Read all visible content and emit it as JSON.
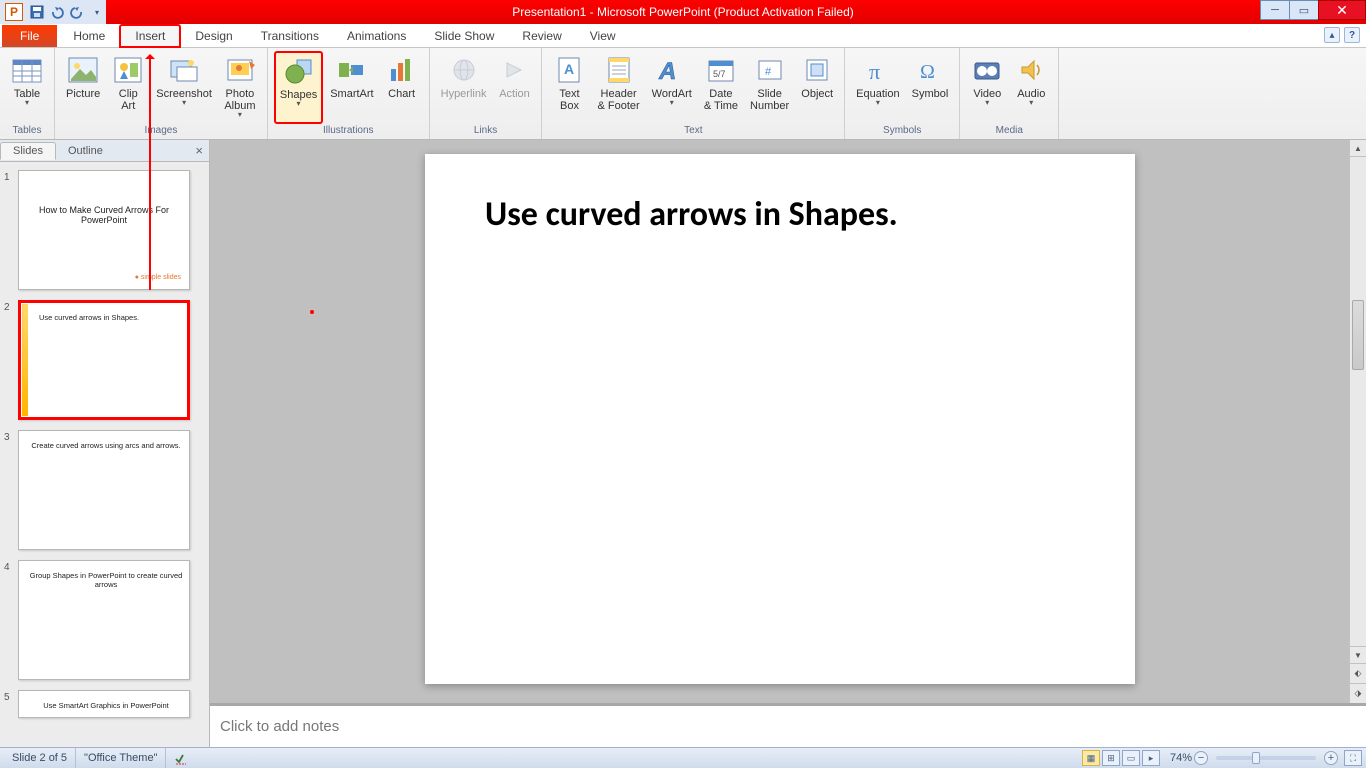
{
  "titlebar": {
    "title": "Presentation1 - Microsoft PowerPoint (Product Activation Failed)"
  },
  "tabs": {
    "file": "File",
    "items": [
      "Home",
      "Insert",
      "Design",
      "Transitions",
      "Animations",
      "Slide Show",
      "Review",
      "View"
    ],
    "active": "Insert"
  },
  "ribbon": {
    "groups": [
      {
        "label": "Tables",
        "items": [
          {
            "name": "table",
            "label": "Table",
            "dropdown": true
          }
        ]
      },
      {
        "label": "Images",
        "items": [
          {
            "name": "picture",
            "label": "Picture"
          },
          {
            "name": "clip-art",
            "label": "Clip\nArt"
          },
          {
            "name": "screenshot",
            "label": "Screenshot",
            "dropdown": true
          },
          {
            "name": "photo-album",
            "label": "Photo\nAlbum",
            "dropdown": true
          }
        ]
      },
      {
        "label": "Illustrations",
        "items": [
          {
            "name": "shapes",
            "label": "Shapes",
            "dropdown": true,
            "highlight": true
          },
          {
            "name": "smartart",
            "label": "SmartArt"
          },
          {
            "name": "chart",
            "label": "Chart"
          }
        ]
      },
      {
        "label": "Links",
        "items": [
          {
            "name": "hyperlink",
            "label": "Hyperlink",
            "disabled": true
          },
          {
            "name": "action",
            "label": "Action",
            "disabled": true
          }
        ]
      },
      {
        "label": "Text",
        "items": [
          {
            "name": "text-box",
            "label": "Text\nBox"
          },
          {
            "name": "header-footer",
            "label": "Header\n& Footer"
          },
          {
            "name": "wordart",
            "label": "WordArt",
            "dropdown": true
          },
          {
            "name": "date-time",
            "label": "Date\n& Time"
          },
          {
            "name": "slide-number",
            "label": "Slide\nNumber"
          },
          {
            "name": "object",
            "label": "Object"
          }
        ]
      },
      {
        "label": "Symbols",
        "items": [
          {
            "name": "equation",
            "label": "Equation",
            "dropdown": true
          },
          {
            "name": "symbol",
            "label": "Symbol"
          }
        ]
      },
      {
        "label": "Media",
        "items": [
          {
            "name": "video",
            "label": "Video",
            "dropdown": true
          },
          {
            "name": "audio",
            "label": "Audio",
            "dropdown": true
          }
        ]
      }
    ]
  },
  "leftPanel": {
    "tabs": [
      "Slides",
      "Outline"
    ],
    "active": "Slides",
    "thumbs": [
      {
        "n": "1",
        "title": "How to Make Curved Arrows For PowerPoint",
        "sub": "simple slides"
      },
      {
        "n": "2",
        "title": "Use curved arrows in Shapes.",
        "selected": true
      },
      {
        "n": "3",
        "title": "Create curved arrows using arcs and arrows."
      },
      {
        "n": "4",
        "title": "Group Shapes in PowerPoint to create curved arrows"
      },
      {
        "n": "5",
        "title": "Use SmartArt Graphics in PowerPoint"
      }
    ]
  },
  "slide": {
    "heading": "Use curved arrows in Shapes."
  },
  "notes": {
    "placeholder": "Click to add notes"
  },
  "status": {
    "slide": "Slide 2 of 5",
    "theme": "\"Office Theme\"",
    "zoom": "74%"
  }
}
